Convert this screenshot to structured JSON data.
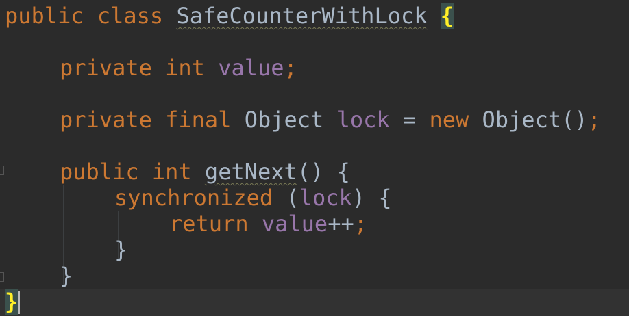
{
  "editor": {
    "language": "Java",
    "theme_colors": {
      "background": "#2b2b2b",
      "keyword": "#cc7832",
      "field": "#9876aa",
      "text": "#a9b7c6",
      "brace_highlight": "#ffef28",
      "current_line": "#323232"
    },
    "code": {
      "l1": {
        "kw_public": "public",
        "kw_class": "class",
        "class_name": "SafeCounterWithLock",
        "open_brace": "{"
      },
      "l2": {
        "kw_private": "private",
        "kw_int": "int",
        "field_value": "value",
        "semicolon": ";"
      },
      "l3": {
        "kw_private": "private",
        "kw_final": "final",
        "type_object": "Object",
        "field_lock": "lock",
        "equals": "=",
        "kw_new": "new",
        "ctor_object": "Object()",
        "semicolon": ";"
      },
      "l4": {
        "kw_public": "public",
        "kw_int": "int",
        "method_name": "getNext",
        "params": "()",
        "open_brace": "{"
      },
      "l5": {
        "kw_synchronized": "synchronized",
        "open_paren": "(",
        "field_lock": "lock",
        "close_paren_brace": ") {"
      },
      "l6": {
        "kw_return": "return",
        "field_value": "value",
        "increment": "++",
        "semicolon": ";"
      },
      "l7": {
        "close_brace": "}"
      },
      "l8": {
        "close_brace": "}"
      },
      "l9": {
        "close_brace": "}"
      }
    }
  }
}
